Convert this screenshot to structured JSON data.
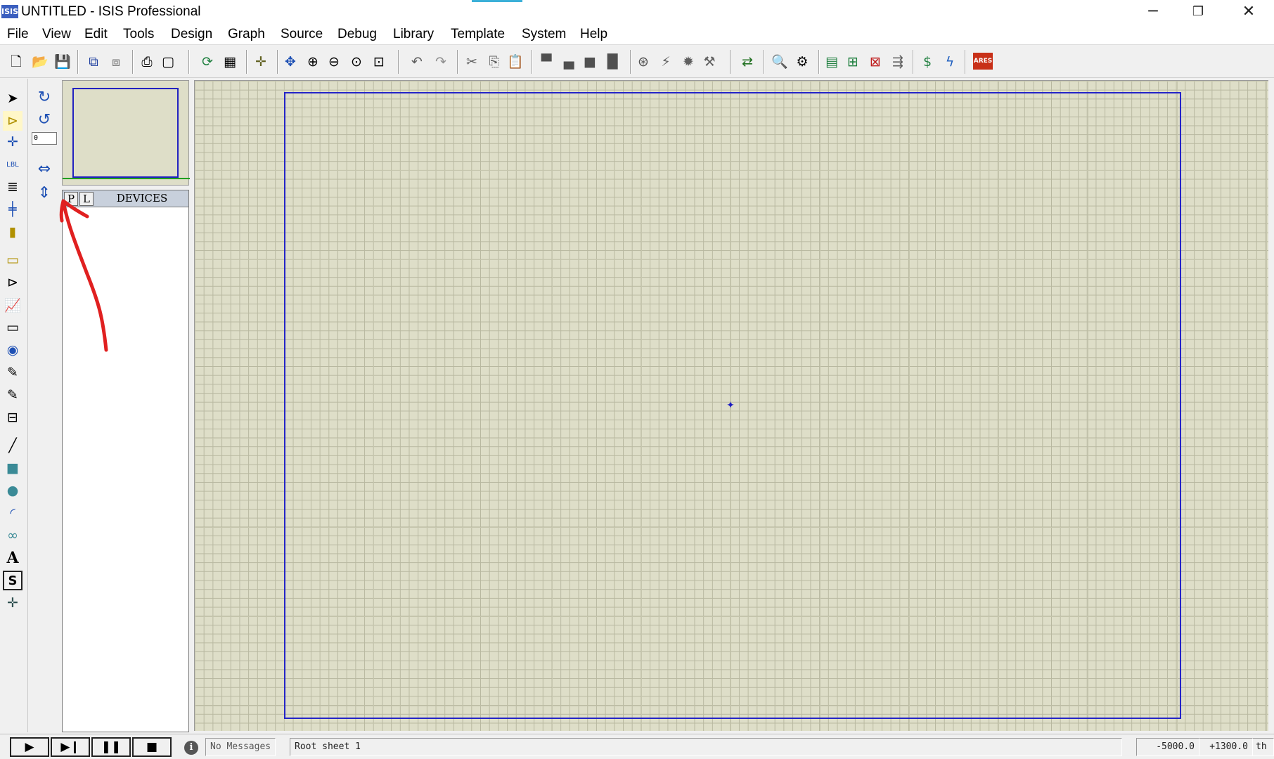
{
  "window": {
    "title": "UNTITLED - ISIS Professional",
    "logo_text": "ISIS",
    "minimize": "─",
    "restore": "❐",
    "close": "✕",
    "accent_color": "#3bb0d8"
  },
  "menu": {
    "items": [
      "File",
      "View",
      "Edit",
      "Tools",
      "Design",
      "Graph",
      "Source",
      "Debug",
      "Library",
      "Template",
      "System",
      "Help"
    ]
  },
  "toolbar": {
    "icons": [
      "new-file-icon",
      "open-file-icon",
      "save-icon",
      "import-section-icon",
      "export-section-icon",
      "print-icon",
      "set-area-icon",
      "redraw-icon",
      "toggle-grid-icon",
      "toggle-origin-icon",
      "pan-icon",
      "zoom-in-icon",
      "zoom-out-icon",
      "zoom-all-icon",
      "zoom-area-icon",
      "undo-icon",
      "redo-icon",
      "cut-icon",
      "copy-icon",
      "paste-icon",
      "block-copy-icon",
      "block-move-icon",
      "block-rotate-icon",
      "block-delete-icon",
      "pick-device-icon",
      "make-device-icon",
      "packaging-tool-icon",
      "decompose-icon",
      "wire-autorouter-icon",
      "search-tag-icon",
      "property-assignment-icon",
      "design-explorer-icon",
      "new-sheet-icon",
      "remove-sheet-icon",
      "goto-sheet-icon",
      "bill-of-materials-icon",
      "electrical-rule-check-icon",
      "netlist-to-ares-icon"
    ],
    "ares_label": "ARES"
  },
  "left_tools": {
    "icons": [
      "selection-mode-icon",
      "component-mode-icon",
      "junction-dot-icon",
      "wire-label-icon",
      "text-script-icon",
      "buses-icon",
      "subcircuit-icon",
      "terminals-icon",
      "device-pins-icon",
      "graph-mode-icon",
      "tape-recorder-icon",
      "generator-icon",
      "voltage-probe-icon",
      "current-probe-icon",
      "virtual-instruments-icon",
      "line-2d-icon",
      "box-2d-icon",
      "circle-2d-icon",
      "arc-2d-icon",
      "closed-path-2d-icon",
      "text-2d-icon",
      "symbol-2d-icon",
      "markers-2d-icon"
    ],
    "lbl_text": "LBL",
    "text_glyph": "A",
    "symbol_glyph": "S"
  },
  "rotation_tools": {
    "rotate_cw": "↻",
    "rotate_ccw": "↺",
    "angle_value": "0",
    "mirror_x": "⇔",
    "mirror_y": "⇕"
  },
  "devices_panel": {
    "p_button": "P",
    "l_button": "L",
    "title": "DEVICES",
    "items": []
  },
  "canvas": {
    "background": "#dedec8",
    "origin_glyph": "✦"
  },
  "annotation": {
    "color": "#e02020",
    "description": "arrow pointing to P button"
  },
  "statusbar": {
    "play": "▶",
    "step": "▶❙",
    "pause": "❚❚",
    "stop": "■",
    "info": "i",
    "messages": "No Messages",
    "sheet": "Root sheet 1",
    "coord_x": "-5000.0",
    "coord_y": "+1300.0",
    "units": "th"
  }
}
